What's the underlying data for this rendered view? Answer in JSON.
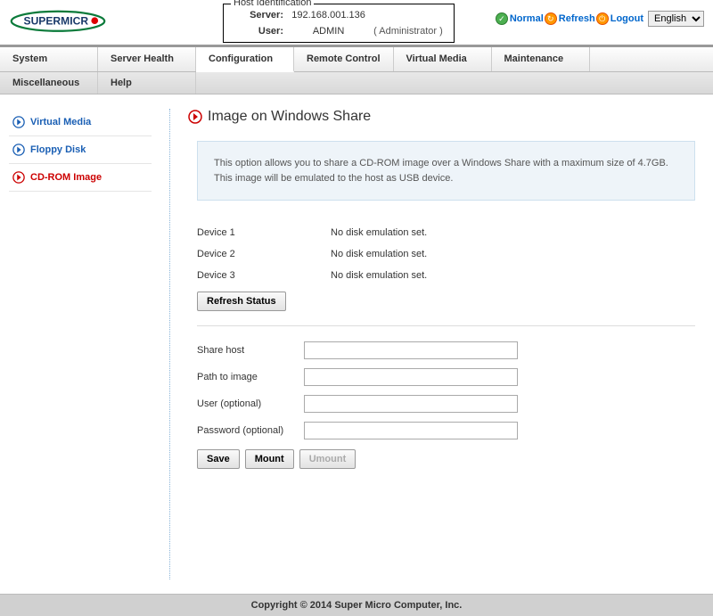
{
  "header": {
    "host_id_title": "Host Identification",
    "server_label": "Server:",
    "server_value": "192.168.001.136",
    "user_label": "User:",
    "user_value": "ADMIN",
    "user_role": "( Administrator )",
    "normal_label": "Normal",
    "refresh_label": "Refresh",
    "logout_label": "Logout",
    "language": "English"
  },
  "nav": {
    "main": [
      "System",
      "Server Health",
      "Configuration",
      "Remote Control",
      "Virtual Media",
      "Maintenance"
    ],
    "sub": [
      "Miscellaneous",
      "Help"
    ]
  },
  "sidebar": {
    "items": [
      {
        "label": "Virtual Media"
      },
      {
        "label": "Floppy Disk"
      },
      {
        "label": "CD-ROM Image"
      }
    ]
  },
  "page": {
    "title": "Image on Windows Share",
    "info": "This option allows you to share a CD-ROM image over a Windows Share with a maximum size of 4.7GB. This image will be emulated to the host as USB device.",
    "devices": [
      {
        "label": "Device 1",
        "status": "No disk emulation set."
      },
      {
        "label": "Device 2",
        "status": "No disk emulation set."
      },
      {
        "label": "Device 3",
        "status": "No disk emulation set."
      }
    ],
    "refresh_btn": "Refresh Status",
    "form": {
      "share_host_label": "Share host",
      "path_label": "Path to image",
      "user_label": "User (optional)",
      "password_label": "Password (optional)"
    },
    "buttons": {
      "save": "Save",
      "mount": "Mount",
      "umount": "Umount"
    }
  },
  "footer": "Copyright © 2014 Super Micro Computer, Inc."
}
